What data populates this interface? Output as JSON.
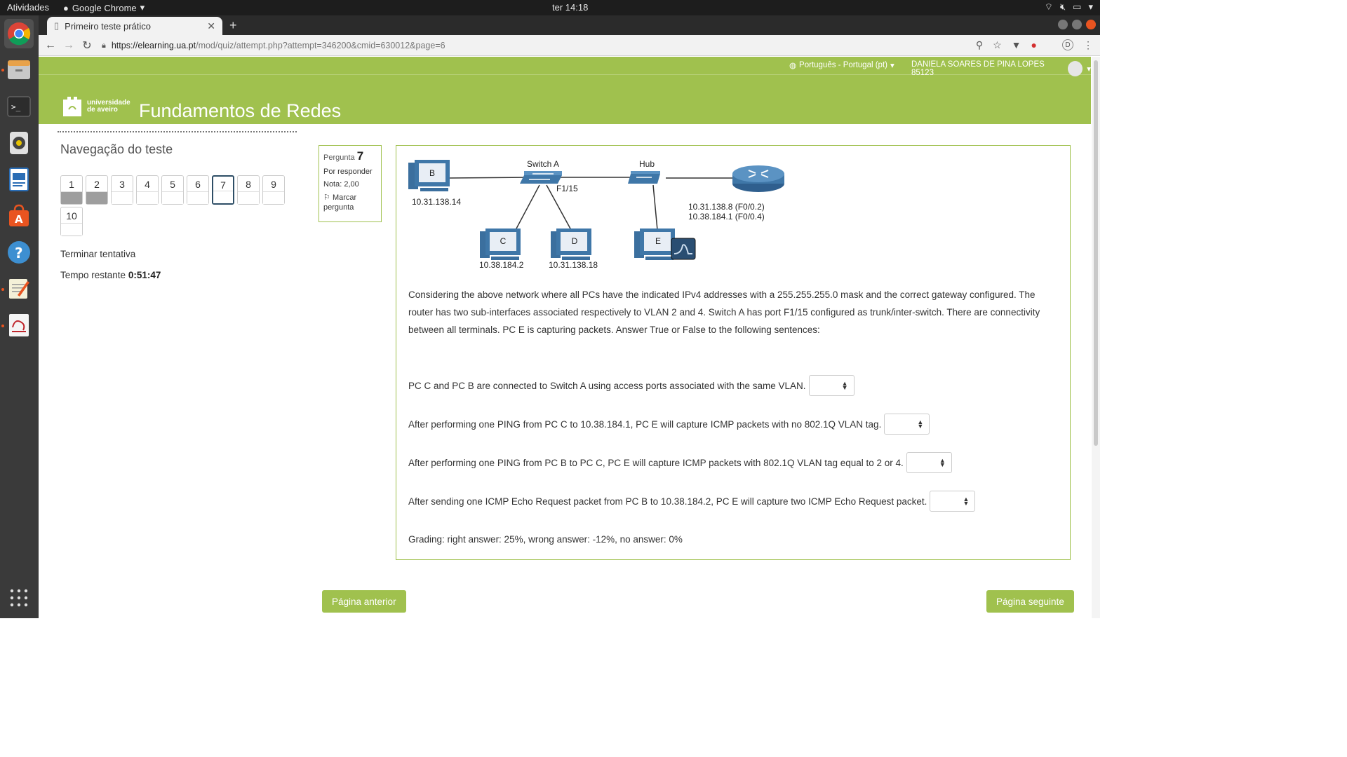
{
  "topbar": {
    "activities": "Atividades",
    "app_name": "Google Chrome",
    "clock": "ter 14:18"
  },
  "dock": {
    "apps": [
      "chrome-icon",
      "files-icon",
      "terminal-icon",
      "rhythmbox-icon",
      "writer-icon",
      "software-center-icon",
      "help-icon",
      "text-editor-icon",
      "evince-icon",
      "app-grid-icon"
    ]
  },
  "browser": {
    "tab_title": "Primeiro teste prático",
    "url_host": "https://elearning.ua.pt",
    "url_path": "/mod/quiz/attempt.php?attempt=346200&cmid=630012&page=6",
    "profile_initial": "D"
  },
  "header": {
    "language": "Português - Portugal (pt)",
    "user_name": "DANIELA SOARES DE PINA LOPES 85123",
    "logo_text_line1": "universidade",
    "logo_text_line2": "de aveiro",
    "site_title": "Fundamentos de Redes"
  },
  "quiz_nav": {
    "title": "Navegação do teste",
    "questions": [
      {
        "label": "1",
        "state": "answered"
      },
      {
        "label": "2",
        "state": "answered"
      },
      {
        "label": "3",
        "state": "empty"
      },
      {
        "label": "4",
        "state": "empty"
      },
      {
        "label": "5",
        "state": "empty"
      },
      {
        "label": "6",
        "state": "empty"
      },
      {
        "label": "7",
        "state": "current"
      },
      {
        "label": "8",
        "state": "empty"
      },
      {
        "label": "9",
        "state": "empty"
      },
      {
        "label": "10",
        "state": "empty"
      }
    ],
    "finish_label": "Terminar tentativa",
    "time_label": "Tempo restante",
    "time_value": "0:51:47"
  },
  "question_info": {
    "label": "Pergunta",
    "number": "7",
    "status": "Por responder",
    "grade": "Nota: 2,00",
    "flag_label_1": "Marcar",
    "flag_label_2": "pergunta"
  },
  "diagram": {
    "pc_b": "B",
    "pc_b_ip": "10.31.138.14",
    "switch_label": "Switch A",
    "port_label": "F1/15",
    "hub_label": "Hub",
    "router_ip_1": "10.31.138.8 (F0/0.2)",
    "router_ip_2": "10.38.184.1 (F0/0.4)",
    "pc_c": "C",
    "pc_c_ip": "10.38.184.2",
    "pc_d": "D",
    "pc_d_ip": "10.31.138.18",
    "pc_e": "E"
  },
  "question": {
    "text": "Considering the above network where all PCs have the indicated IPv4 addresses with a 255.255.255.0 mask and the correct gateway configured. The router has two sub-interfaces associated respectively to VLAN 2 and 4. Switch A has port F1/15 configured as trunk/inter-switch. There are connectivity between all terminals. PC E is capturing packets. Answer True or False to the following sentences:",
    "statements": [
      "PC C and PC B are connected to Switch A using access ports associated with the same VLAN.",
      "After performing one PING from PC C to 10.38.184.1, PC E will capture ICMP packets with no 802.1Q VLAN tag.",
      "After performing one PING from PC B to PC C, PC E will capture ICMP packets with 802.1Q VLAN tag equal to 2 or 4.",
      "After sending one ICMP Echo Request packet from PC B to 10.38.184.2, PC E will capture two ICMP Echo Request packet."
    ],
    "grading": "Grading: right answer: 25%, wrong answer: -12%, no answer: 0%"
  },
  "buttons": {
    "prev": "Página anterior",
    "next": "Página seguinte"
  },
  "colors": {
    "accent_green": "#a0c14e",
    "dock_bg": "#3a3a3a",
    "topbar_bg": "#1d1d1d",
    "current_border": "#2e4e66"
  }
}
